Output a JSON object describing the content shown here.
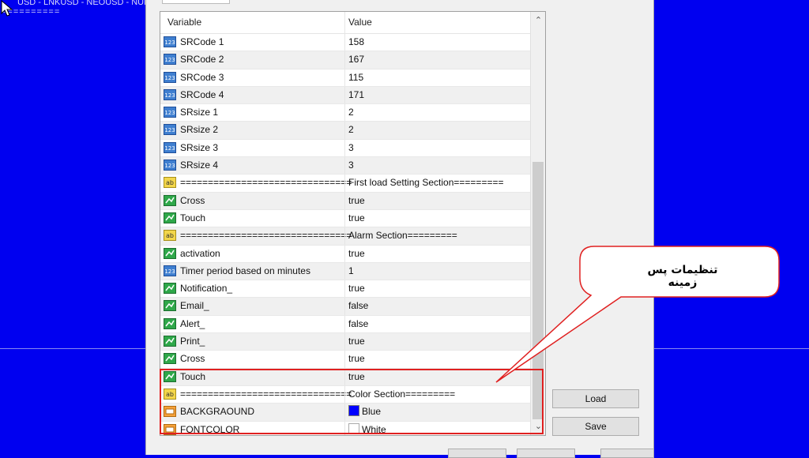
{
  "chart": {
    "title": "USD - LNKUSD - NEOUSD - NULU",
    "subtitle": "=========="
  },
  "grid": {
    "headers": {
      "variable": "Variable",
      "value": "Value"
    },
    "rows": [
      {
        "icon": "num",
        "name": "SRCode 1",
        "value": "158"
      },
      {
        "icon": "num",
        "name": "SRCode 2",
        "value": "167"
      },
      {
        "icon": "num",
        "name": "SRCode 3",
        "value": "115"
      },
      {
        "icon": "num",
        "name": "SRCode 4",
        "value": "171"
      },
      {
        "icon": "num",
        "name": "SRsize 1",
        "value": "2"
      },
      {
        "icon": "num",
        "name": "SRsize 2",
        "value": "2"
      },
      {
        "icon": "num",
        "name": "SRsize 3",
        "value": "3"
      },
      {
        "icon": "num",
        "name": "SRsize 4",
        "value": "3"
      },
      {
        "icon": "str",
        "name": "===============================",
        "value": "First load Setting Section========="
      },
      {
        "icon": "bool",
        "name": "Cross",
        "value": "true"
      },
      {
        "icon": "bool",
        "name": "Touch",
        "value": "true"
      },
      {
        "icon": "str",
        "name": "===============================",
        "value": "Alarm Section========="
      },
      {
        "icon": "bool",
        "name": "activation",
        "value": "true"
      },
      {
        "icon": "num",
        "name": "Timer period based on minutes",
        "value": "1"
      },
      {
        "icon": "bool",
        "name": "Notification_",
        "value": "true"
      },
      {
        "icon": "bool",
        "name": "Email_",
        "value": "false"
      },
      {
        "icon": "bool",
        "name": "Alert_",
        "value": "false"
      },
      {
        "icon": "bool",
        "name": "Print_",
        "value": "true"
      },
      {
        "icon": "bool",
        "name": "Cross",
        "value": "true"
      },
      {
        "icon": "bool",
        "name": "Touch",
        "value": "true"
      },
      {
        "icon": "str",
        "name": "===============================",
        "value": "Color Section========="
      },
      {
        "icon": "color",
        "name": "BACKGRAOUND",
        "value": "Blue",
        "swatch": "#0000ff"
      },
      {
        "icon": "color",
        "name": "FONTCOLOR",
        "value": "White",
        "swatch": "#ffffff"
      }
    ]
  },
  "buttons": {
    "load": "Load",
    "save": "Save"
  },
  "annotation": {
    "text": "تنظیمات پس زمینه"
  },
  "colors": {
    "chart_bg": "#0000f0",
    "highlight": "#e02020"
  }
}
